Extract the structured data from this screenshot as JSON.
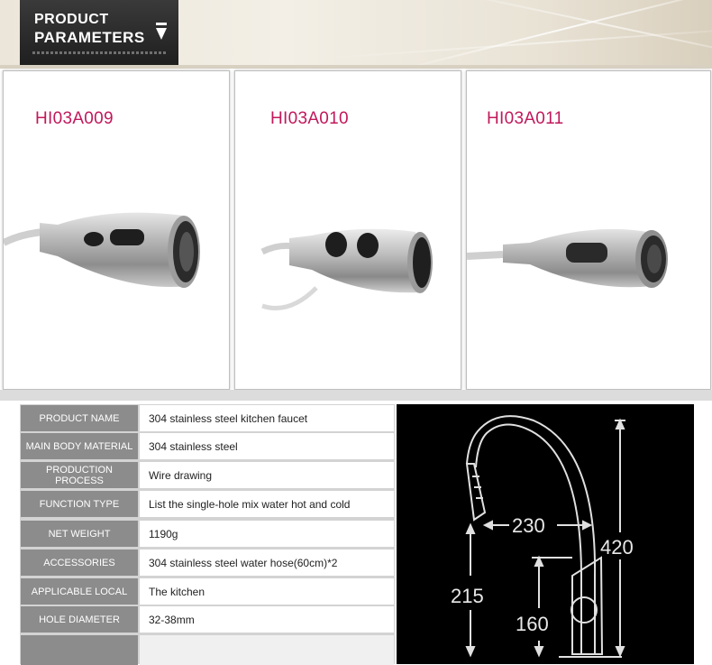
{
  "header": {
    "title_line1": "PRODUCT",
    "title_line2": "PARAMETERS"
  },
  "products": [
    {
      "code": "HI03A009"
    },
    {
      "code": "HI03A010"
    },
    {
      "code": "HI03A011"
    }
  ],
  "colors": {
    "code_text": "#c1185b",
    "label_bg": "#8c8c8c",
    "header_tag": "#2a2a2a",
    "drawing_bg": "#000000"
  },
  "specs": [
    {
      "label": "PRODUCT NAME",
      "value": "304 stainless steel kitchen faucet"
    },
    {
      "label": "MAIN BODY MATERIAL",
      "value": "304 stainless steel"
    },
    {
      "label": "PRODUCTION PROCESS",
      "value": "Wire drawing"
    },
    {
      "label": "FUNCTION TYPE",
      "value": "List the single-hole mix water hot and cold"
    },
    {
      "label": "NET WEIGHT",
      "value": "1190g"
    },
    {
      "label": "ACCESSORIES",
      "value": "304 stainless steel water hose(60cm)*2"
    },
    {
      "label": "APPLICABLE LOCAL",
      "value": "The kitchen"
    },
    {
      "label": "HOLE DIAMETER",
      "value": "32-38mm"
    },
    {
      "label": "",
      "value": ""
    }
  ],
  "dimensions": {
    "spout_reach": "230",
    "total_height": "420",
    "spout_height": "215",
    "body_height": "160"
  },
  "icons": {
    "header_arrow": "chevron-down-icon"
  }
}
